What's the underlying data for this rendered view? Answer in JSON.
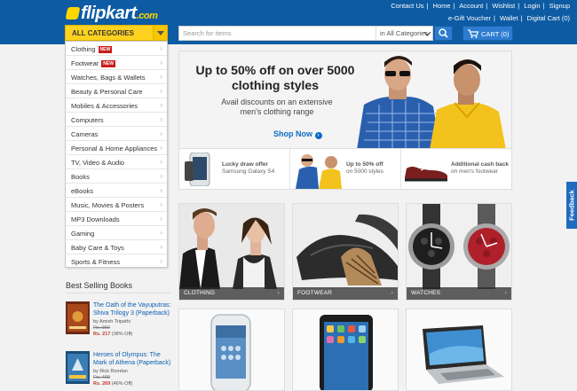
{
  "header": {
    "logo_text": "flipkart",
    "logo_suffix": ".com",
    "top_links": [
      "Contact Us",
      "Home",
      "Account",
      "Wishlist",
      "Login",
      "Signup"
    ],
    "sub_links": [
      "e-Gift Voucher",
      "Wallet",
      "Digital Cart (0)"
    ],
    "all_categories_label": "ALL CATEGORIES",
    "search_placeholder": "Search for items",
    "search_scope": "in All Categories",
    "cart_label": "CART (0)"
  },
  "categories": [
    {
      "label": "Clothing",
      "badge": "NEW"
    },
    {
      "label": "Footwear",
      "badge": "NEW"
    },
    {
      "label": "Watches, Bags & Wallets"
    },
    {
      "label": "Beauty & Personal Care"
    },
    {
      "label": "Mobiles & Accessories"
    },
    {
      "label": "Computers"
    },
    {
      "label": "Cameras"
    },
    {
      "label": "Personal & Home Appliances"
    },
    {
      "label": "TV, Video & Audio"
    },
    {
      "label": "Books"
    },
    {
      "label": "eBooks"
    },
    {
      "label": "Music, Movies & Posters"
    },
    {
      "label": "MP3 Downloads"
    },
    {
      "label": "Gaming"
    },
    {
      "label": "Baby Care & Toys"
    },
    {
      "label": "Sports & Fitness"
    }
  ],
  "bestsellers": {
    "title": "Best Selling Books",
    "books": [
      {
        "title": "The Oath of the Vayuputras: Shiva Trilogy 3 (Paperback)",
        "author": "by Amish Tripathi",
        "old_price": "Rs. 350",
        "price": "Rs. 217",
        "discount": "(38% Off)"
      },
      {
        "title": "Heroes of Olympus: The Mark of Athena (Paperback)",
        "author": "by Rick Riordan",
        "old_price": "Rs. 499",
        "price": "Rs. 269",
        "discount": "(46% Off)"
      }
    ]
  },
  "hero": {
    "headline": "Up to 50% off on over 5000 clothing styles",
    "subline": "Avail discounts on an extensive men's clothing range",
    "cta": "Shop Now"
  },
  "promo_strip": [
    {
      "line1": "Lucky draw offer",
      "line2": "Samsung Galaxy S4"
    },
    {
      "line1": "Up to 50% off",
      "line2": "on 5000 styles"
    },
    {
      "line1": "Additional cash back",
      "line2": "on men's footwear"
    }
  ],
  "tiles": [
    {
      "label": "CLOTHING"
    },
    {
      "label": "FOOTWEAR"
    },
    {
      "label": "WATCHES"
    },
    {
      "label": ""
    },
    {
      "label": ""
    },
    {
      "label": ""
    }
  ],
  "feedback_label": "Feedback",
  "colors": {
    "brand_blue": "#0d5ba3",
    "accent_yellow": "#ffd21f",
    "new_badge": "#c81e1e",
    "link_blue": "#0a5fb0"
  }
}
